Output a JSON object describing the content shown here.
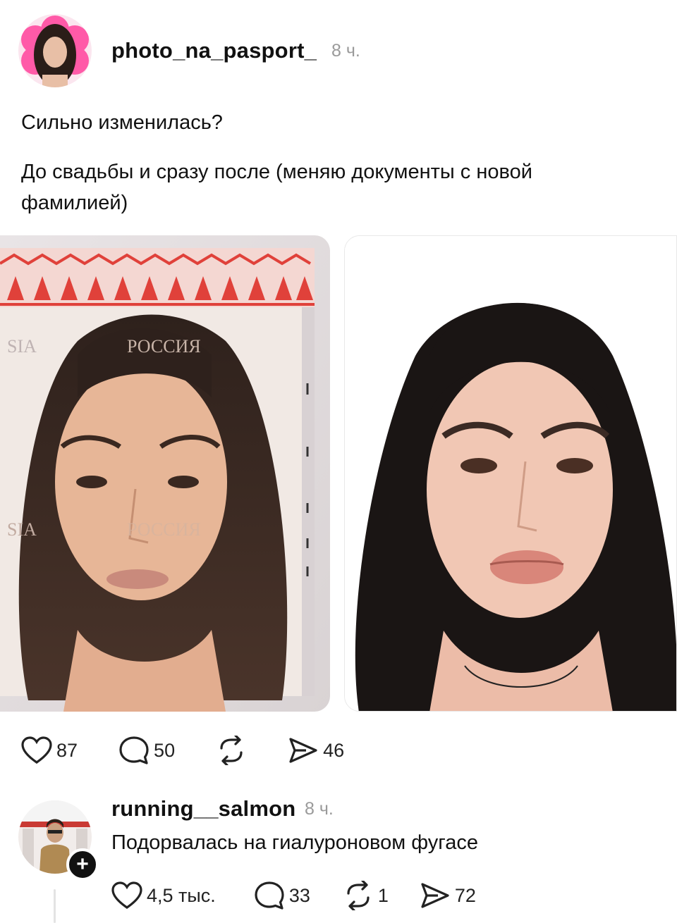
{
  "post": {
    "username": "photo_na_pasport_",
    "time": "8 ч.",
    "text_line1": "Сильно изменилась?",
    "text_line2": "До свадьбы и сразу после (меняю документы с новой фамилией)",
    "images": [
      {
        "kind": "passport-photo",
        "watermark_text": "РОССИЯ"
      },
      {
        "kind": "portrait-photo"
      }
    ],
    "actions": {
      "likes": "87",
      "comments": "50",
      "shares": "46"
    },
    "icons": [
      "heart-icon",
      "comment-icon",
      "repost-icon",
      "share-icon"
    ]
  },
  "comment": {
    "username": "running__salmon",
    "time": "8 ч.",
    "text": "Подорвалась на гиалуроновом фугасе",
    "follow_badge": "+",
    "actions": {
      "likes": "4,5 тыс.",
      "comments": "33",
      "reposts": "1",
      "shares": "72"
    }
  },
  "colors": {
    "avatar_ring": "#ff5aa8",
    "passport_ornament": "#e0413a",
    "text": "#111111",
    "muted": "#9a9a9a"
  }
}
